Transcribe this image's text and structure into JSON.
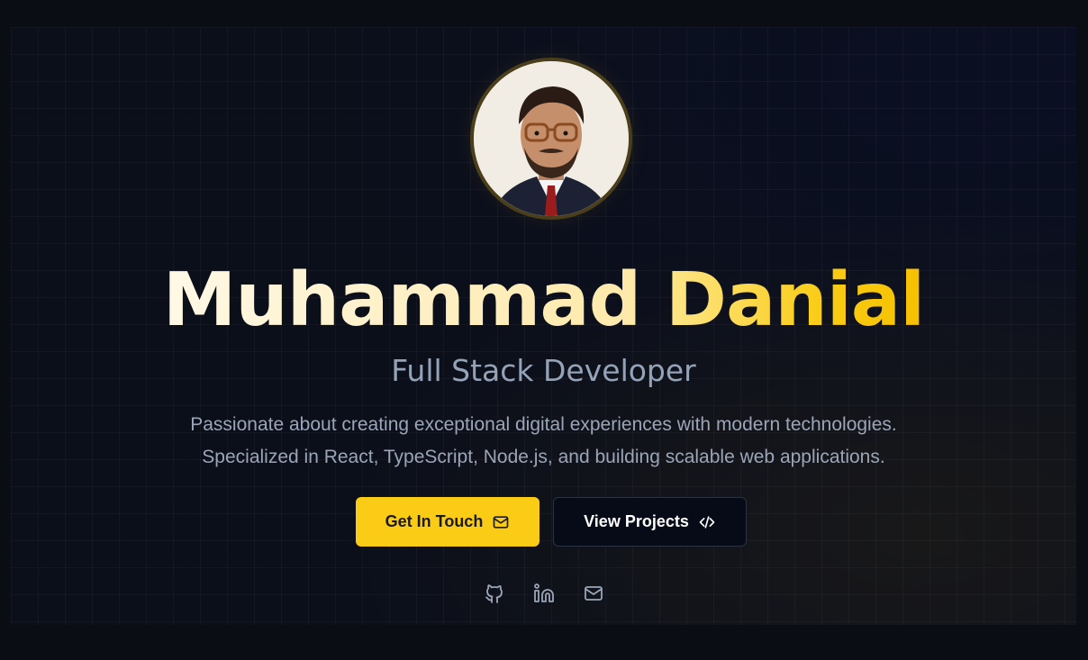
{
  "profile": {
    "first_name": "Muhammad",
    "last_name": "Danial",
    "role": "Full Stack Developer",
    "bio_line1": "Passionate about creating exceptional digital experiences with modern technologies.",
    "bio_line2": "Specialized in React, TypeScript, Node.js, and building scalable web applications."
  },
  "buttons": {
    "contact_label": "Get In Touch",
    "contact_icon": "mail-icon",
    "projects_label": "View Projects",
    "projects_icon": "code-icon"
  },
  "socials": [
    {
      "name": "github-icon"
    },
    {
      "name": "linkedin-icon"
    },
    {
      "name": "mail-icon"
    }
  ],
  "colors": {
    "accent": "#facc15",
    "background": "#0b0f1a",
    "muted_text": "#94a3b8"
  }
}
